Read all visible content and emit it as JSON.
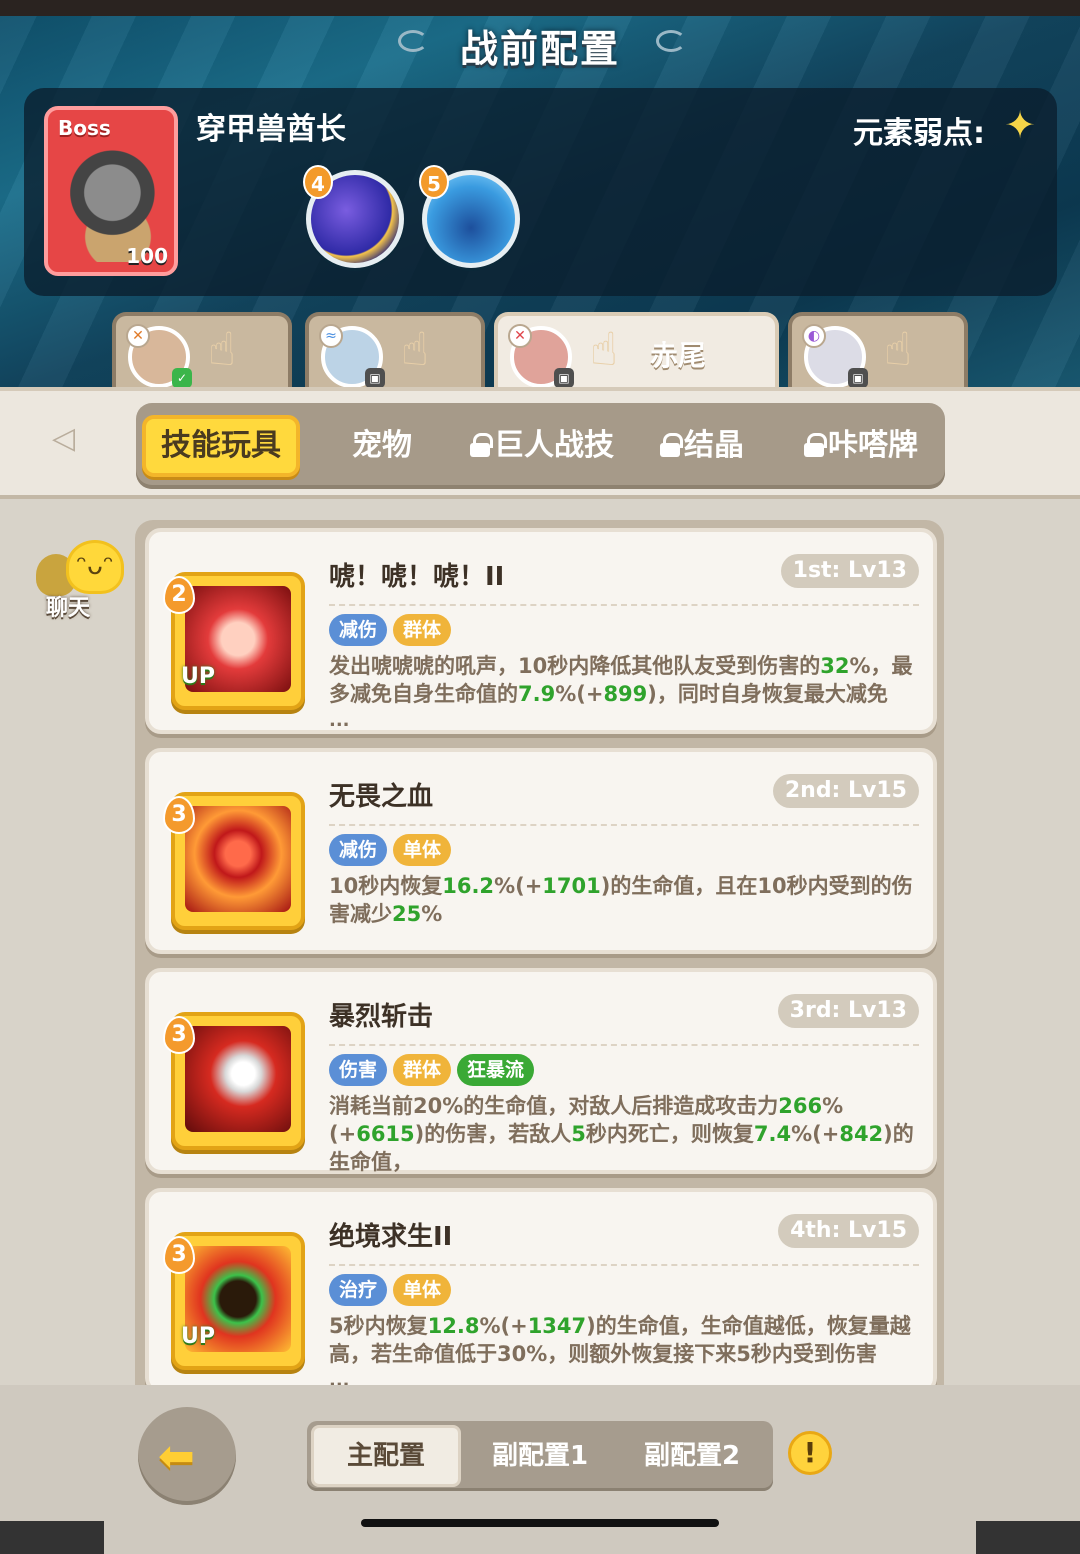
{
  "title": "战前配置",
  "boss": {
    "tag": "Boss",
    "level": "100",
    "name": "穿甲兽酋长",
    "weakness_label": "元素弱点:",
    "skills": [
      {
        "cost": "4",
        "icon": "purple-swirl-orb-icon"
      },
      {
        "cost": "5",
        "icon": "blue-splash-orb-icon"
      }
    ]
  },
  "heroes": [
    {
      "name": "",
      "icon": "hero-avatar-1"
    },
    {
      "name": "",
      "icon": "hero-avatar-2"
    },
    {
      "name": "赤尾",
      "icon": "hero-avatar-3"
    },
    {
      "name": "",
      "icon": "hero-avatar-4"
    }
  ],
  "menu": {
    "tabs": [
      {
        "label": "技能玩具",
        "locked": false
      },
      {
        "label": "宠物",
        "locked": false
      },
      {
        "label": "巨人战技",
        "locked": true
      },
      {
        "label": "结晶",
        "locked": true
      },
      {
        "label": "咔嗒牌",
        "locked": true
      }
    ]
  },
  "chat": {
    "label": "聊天"
  },
  "skills": [
    {
      "cost": "2",
      "up": "UP",
      "name": "唬！唬！唬！II",
      "slot": "1st: Lv13",
      "tags": [
        {
          "label": "减伤",
          "color": "#5b8fd6"
        },
        {
          "label": "群体",
          "color": "#f0b43a"
        }
      ],
      "desc_parts": [
        {
          "t": "发出唬唬唬的吼声，10秒内降低其他队友受到伤害的"
        },
        {
          "t": "32",
          "hl": true
        },
        {
          "t": "%，最多减免自身生命值的"
        },
        {
          "t": "7.9",
          "hl": true
        },
        {
          "t": "%(+"
        },
        {
          "t": "899",
          "hl": true
        },
        {
          "t": ")，同时自身恢复最大减免"
        }
      ],
      "more": "..."
    },
    {
      "cost": "3",
      "up": "",
      "name": "无畏之血",
      "slot": "2nd: Lv15",
      "tags": [
        {
          "label": "减伤",
          "color": "#5b8fd6"
        },
        {
          "label": "单体",
          "color": "#f0b43a"
        }
      ],
      "desc_parts": [
        {
          "t": "10秒内恢复"
        },
        {
          "t": "16.2",
          "hl": true
        },
        {
          "t": "%(+"
        },
        {
          "t": "1701",
          "hl": true
        },
        {
          "t": ")的生命值，且在10秒内受到的伤害减少"
        },
        {
          "t": "25",
          "hl": true
        },
        {
          "t": "%"
        }
      ],
      "more": ""
    },
    {
      "cost": "3",
      "up": "",
      "name": "暴烈斩击",
      "slot": "3rd: Lv13",
      "tags": [
        {
          "label": "伤害",
          "color": "#5b8fd6"
        },
        {
          "label": "群体",
          "color": "#f0b43a"
        },
        {
          "label": "狂暴流",
          "color": "#3aa935"
        }
      ],
      "desc_parts": [
        {
          "t": "消耗当前20%的生命值，对敌人后排造成攻击力"
        },
        {
          "t": "266",
          "hl": true
        },
        {
          "t": "%(+"
        },
        {
          "t": "6615",
          "hl": true
        },
        {
          "t": ")的伤害，若敌人"
        },
        {
          "t": "5",
          "hl": true
        },
        {
          "t": "秒内死亡，则恢复"
        },
        {
          "t": "7.4",
          "hl": true
        },
        {
          "t": "%(+"
        },
        {
          "t": "842",
          "hl": true
        },
        {
          "t": ")的生命值，"
        }
      ],
      "more": "..."
    },
    {
      "cost": "3",
      "up": "UP",
      "name": "绝境求生II",
      "slot": "4th: Lv15",
      "tags": [
        {
          "label": "治疗",
          "color": "#5b8fd6"
        },
        {
          "label": "单体",
          "color": "#f0b43a"
        }
      ],
      "desc_parts": [
        {
          "t": "5秒内恢复"
        },
        {
          "t": "12.8",
          "hl": true
        },
        {
          "t": "%(+"
        },
        {
          "t": "1347",
          "hl": true
        },
        {
          "t": ")的生命值，生命值越低，恢复量越高，若生命值低于30%，则额外恢复接下来5秒内受到伤害"
        }
      ],
      "more": "..."
    }
  ],
  "config_tabs": [
    "主配置",
    "副配置1",
    "副配置2"
  ],
  "warn_symbol": "!"
}
